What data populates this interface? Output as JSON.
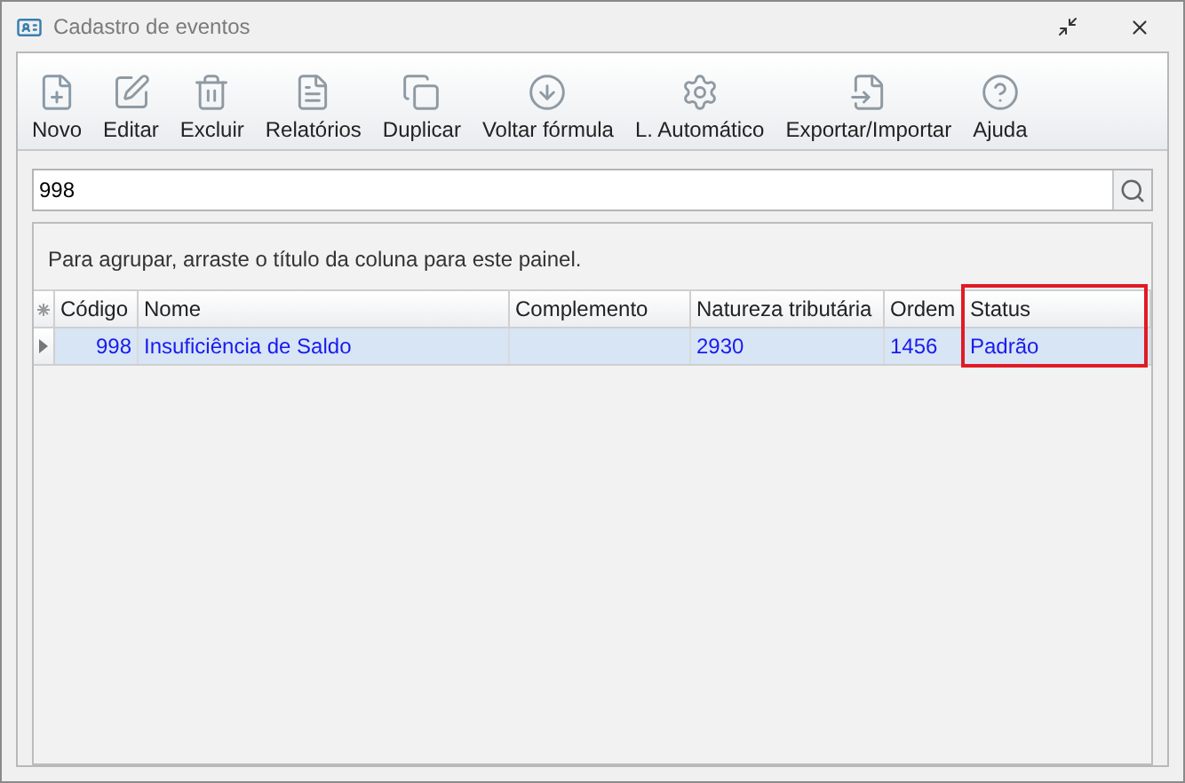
{
  "window": {
    "title": "Cadastro de eventos"
  },
  "toolbar": [
    {
      "label": "Novo",
      "kind": "new"
    },
    {
      "label": "Editar",
      "kind": "edit"
    },
    {
      "label": "Excluir",
      "kind": "delete"
    },
    {
      "label": "Relatórios",
      "kind": "reports"
    },
    {
      "label": "Duplicar",
      "kind": "duplicate"
    },
    {
      "label": "Voltar fórmula",
      "kind": "revert"
    },
    {
      "label": "L. Automático",
      "kind": "auto"
    },
    {
      "label": "Exportar/Importar",
      "kind": "export"
    },
    {
      "label": "Ajuda",
      "kind": "help"
    }
  ],
  "search": {
    "value": "998"
  },
  "grid": {
    "group_hint": "Para agrupar, arraste o título da coluna para este painel.",
    "columns": [
      {
        "label": "Código",
        "highlighted": false
      },
      {
        "label": "Nome",
        "highlighted": false
      },
      {
        "label": "Complemento",
        "highlighted": false
      },
      {
        "label": "Natureza tributária",
        "highlighted": false
      },
      {
        "label": "Ordem",
        "highlighted": false
      },
      {
        "label": "Status",
        "highlighted": true
      }
    ],
    "rows": [
      {
        "selected": true,
        "cells": [
          "998",
          "Insuficiência de Saldo",
          "",
          "2930",
          "1456",
          "Padrão"
        ]
      }
    ]
  }
}
